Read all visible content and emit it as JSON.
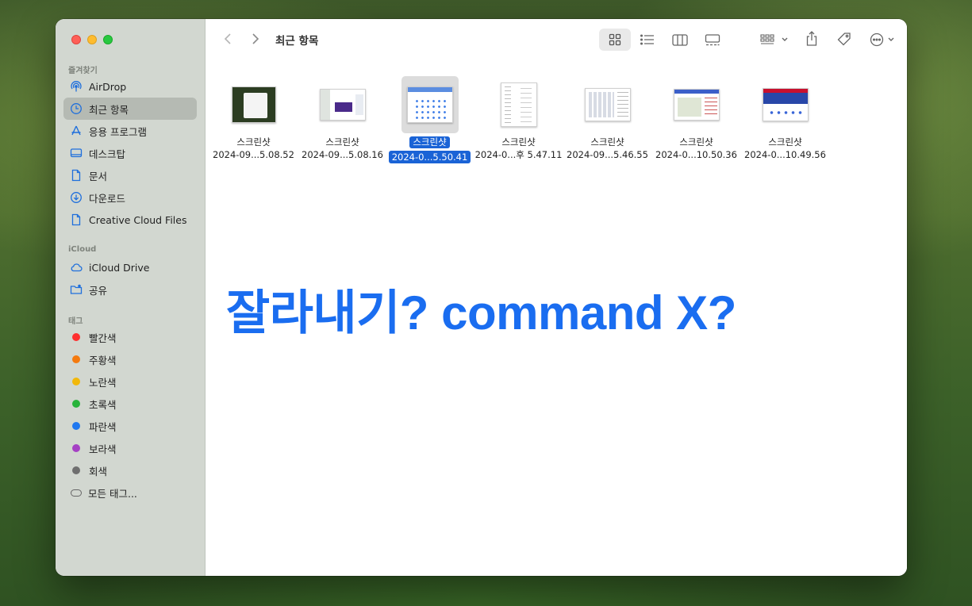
{
  "window": {
    "title": "최근 항목"
  },
  "sidebar": {
    "favorites_label": "즐겨찾기",
    "favorites": [
      {
        "label": "AirDrop",
        "icon": "airdrop-icon"
      },
      {
        "label": "최근 항목",
        "icon": "clock-icon",
        "selected": true
      },
      {
        "label": "응용 프로그램",
        "icon": "applications-icon"
      },
      {
        "label": "데스크탑",
        "icon": "desktop-icon"
      },
      {
        "label": "문서",
        "icon": "document-icon"
      },
      {
        "label": "다운로드",
        "icon": "download-icon"
      },
      {
        "label": "Creative Cloud Files",
        "icon": "file-icon"
      }
    ],
    "icloud_label": "iCloud",
    "icloud": [
      {
        "label": "iCloud Drive",
        "icon": "cloud-icon"
      },
      {
        "label": "공유",
        "icon": "shared-folder-icon"
      }
    ],
    "tags_label": "태그",
    "tags": [
      {
        "label": "빨간색",
        "color": "#fe2f2f"
      },
      {
        "label": "주황색",
        "color": "#f47a0e"
      },
      {
        "label": "노란색",
        "color": "#f2b80a"
      },
      {
        "label": "초록색",
        "color": "#27b33a"
      },
      {
        "label": "파란색",
        "color": "#1f78f0"
      },
      {
        "label": "보라색",
        "color": "#a540c4"
      },
      {
        "label": "회색",
        "color": "#6f6f6f"
      }
    ],
    "all_tags_label": "모든 태그..."
  },
  "toolbar": {
    "icons": [
      "back-icon",
      "forward-icon",
      "icon-view-icon",
      "list-view-icon",
      "column-view-icon",
      "gallery-view-icon",
      "group-icon",
      "share-icon",
      "tag-icon",
      "more-icon",
      "search-icon"
    ]
  },
  "files": [
    {
      "name": "스크린샷",
      "date": "2024-09...5.08.52"
    },
    {
      "name": "스크린샷",
      "date": "2024-09...5.08.16"
    },
    {
      "name": "스크린샷",
      "date": "2024-0...5.50.41",
      "selected": true
    },
    {
      "name": "스크린샷",
      "date": "2024-0...후 5.47.11"
    },
    {
      "name": "스크린샷",
      "date": "2024-09...5.46.55"
    },
    {
      "name": "스크린샷",
      "date": "2024-0...10.50.36"
    },
    {
      "name": "스크린샷",
      "date": "2024-0...10.49.56"
    }
  ],
  "overlay": {
    "text": "잘라내기? command X?",
    "color": "#1a6df0"
  },
  "colors": {
    "selection": "#1a63d6",
    "accent": "#1f6fdc"
  }
}
